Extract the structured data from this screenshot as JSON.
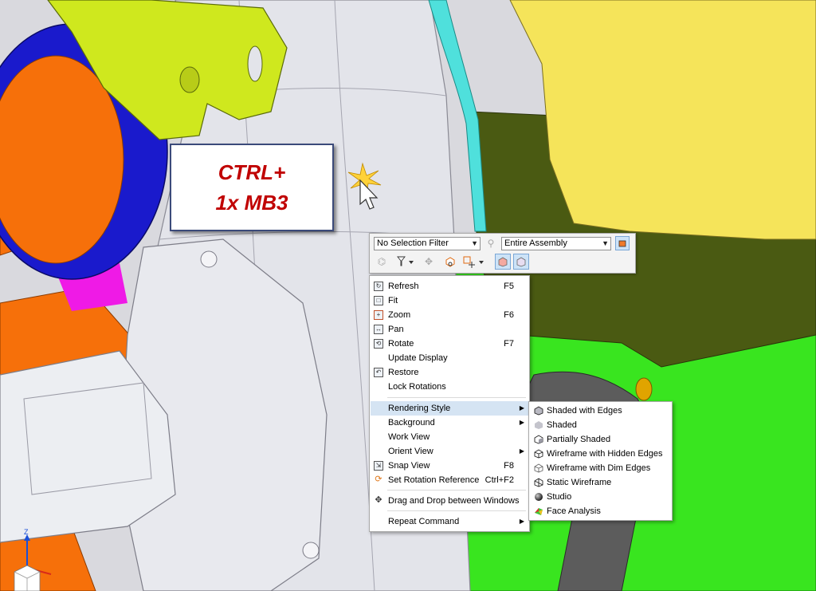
{
  "callout": {
    "line1": "CTRL+",
    "line2": "1x MB3"
  },
  "selection_toolbar": {
    "selection_filter": "No Selection Filter",
    "scope": "Entire Assembly",
    "icons": [
      "filter-icon",
      "select-icon",
      "selection-list-icon",
      "sketch-plane-icon",
      "snap-icon",
      "point-snap-icon",
      "view-icon",
      "component-icon"
    ]
  },
  "context_menu": {
    "items": [
      {
        "label": "Refresh",
        "shortcut": "F5",
        "icon": "refresh-icon"
      },
      {
        "label": "Fit",
        "shortcut": "",
        "icon": "fit-icon"
      },
      {
        "label": "Zoom",
        "shortcut": "F6",
        "icon": "zoom-icon"
      },
      {
        "label": "Pan",
        "shortcut": "",
        "icon": "pan-icon"
      },
      {
        "label": "Rotate",
        "shortcut": "F7",
        "icon": "rotate-icon"
      },
      {
        "label": "Update Display",
        "shortcut": "",
        "icon": ""
      },
      {
        "label": "Restore",
        "shortcut": "",
        "icon": "restore-icon"
      },
      {
        "label": "Lock Rotations",
        "shortcut": "",
        "icon": ""
      },
      {
        "label": "Rendering Style",
        "shortcut": "",
        "icon": "",
        "submenu": true
      },
      {
        "label": "Background",
        "shortcut": "",
        "icon": "",
        "submenu": true
      },
      {
        "label": "Work View",
        "shortcut": "",
        "icon": ""
      },
      {
        "label": "Orient View",
        "shortcut": "",
        "icon": "",
        "submenu": true
      },
      {
        "label": "Snap View",
        "shortcut": "F8",
        "icon": "snap-view-icon"
      },
      {
        "label": "Set Rotation Reference",
        "shortcut": "Ctrl+F2",
        "icon": "rotation-reference-icon"
      },
      {
        "label": "Drag and Drop between Windows",
        "shortcut": "",
        "icon": "drag-drop-icon"
      },
      {
        "label": "Repeat Command",
        "shortcut": "",
        "icon": "",
        "submenu": true
      }
    ]
  },
  "rendering_submenu": {
    "items": [
      {
        "label": "Shaded with Edges",
        "icon": "shaded-edges-icon"
      },
      {
        "label": "Shaded",
        "icon": "shaded-icon"
      },
      {
        "label": "Partially Shaded",
        "icon": "partially-shaded-icon"
      },
      {
        "label": "Wireframe with Hidden Edges",
        "icon": "wireframe-hidden-icon"
      },
      {
        "label": "Wireframe with Dim Edges",
        "icon": "wireframe-dim-icon"
      },
      {
        "label": "Static Wireframe",
        "icon": "static-wireframe-icon"
      },
      {
        "label": "Studio",
        "icon": "studio-icon"
      },
      {
        "label": "Face Analysis",
        "icon": "face-analysis-icon"
      }
    ]
  },
  "triad": {
    "z_label": "Z"
  },
  "colors": {
    "callout_text": "#c00000",
    "menu_highlight": "#d5e4f3",
    "part_yellow": "#f5e45a",
    "part_green": "#33e61a",
    "part_cyan": "#4fe0dc",
    "part_blue": "#1a1acc",
    "part_orange": "#f6700a"
  }
}
